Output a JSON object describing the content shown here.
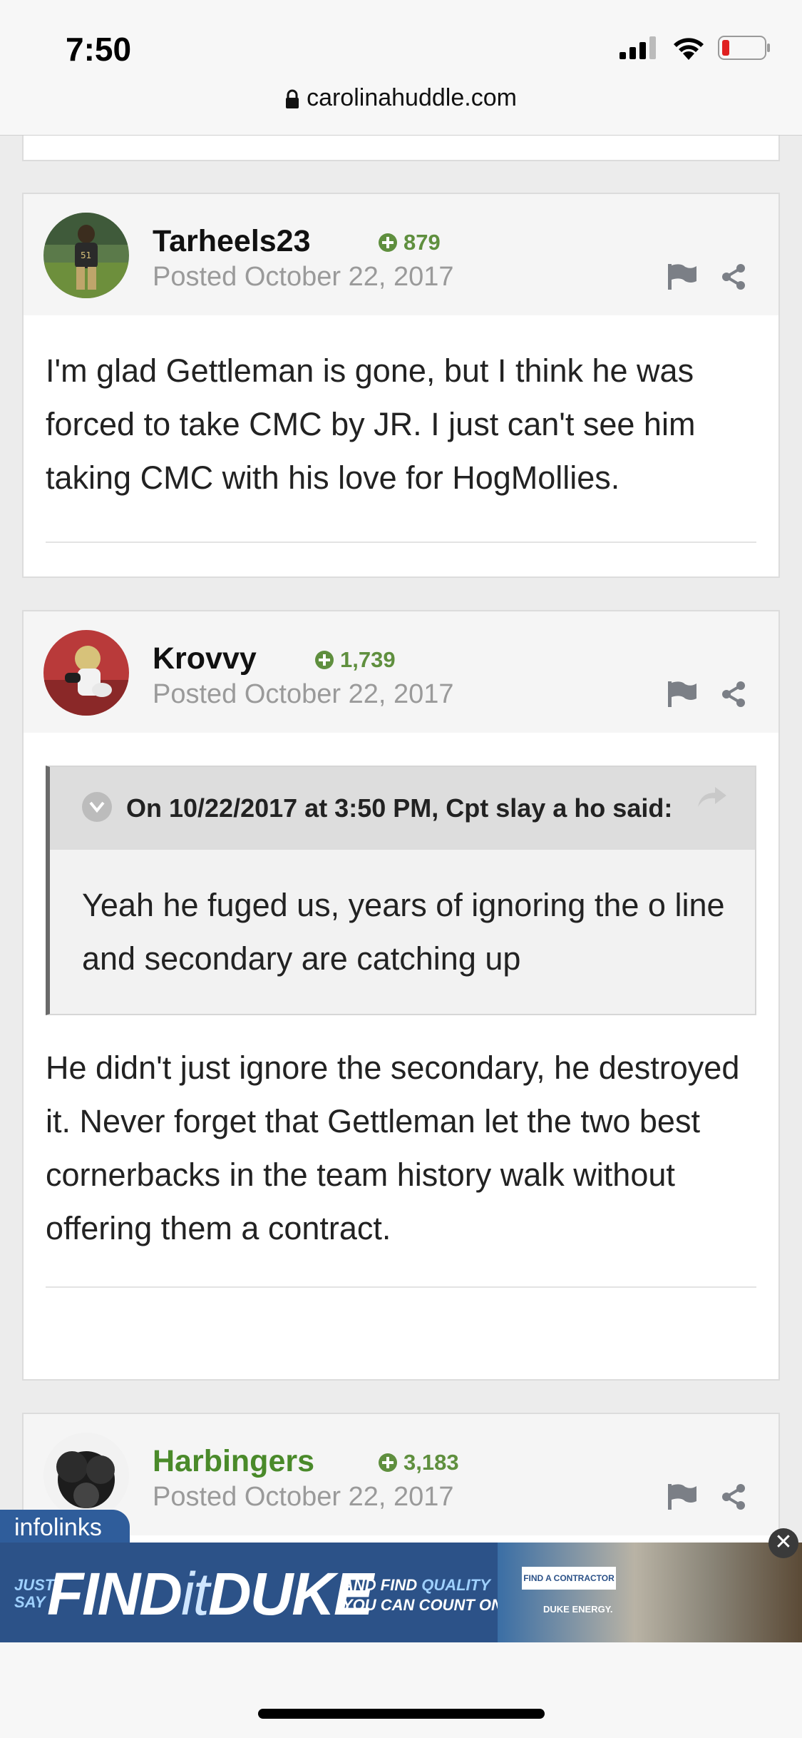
{
  "status_bar": {
    "time": "7:50"
  },
  "browser": {
    "url": "carolinahuddle.com"
  },
  "posts": [
    {
      "username": "Tarheels23",
      "reputation": "879",
      "posted": "Posted October 22, 2017",
      "content": "I'm glad Gettleman is gone, but I think he was forced to take CMC by JR. I just can't see him taking CMC with his love for HogMollies."
    },
    {
      "username": "Krovvy",
      "reputation": "1,739",
      "posted": "Posted October 22, 2017",
      "quote": {
        "citation": "On 10/22/2017 at 3:50 PM, Cpt slay a ho said:",
        "text": "Yeah he fuged us, years of ignoring the o line and secondary are catching up"
      },
      "content": "He didn't just ignore the secondary, he destroyed it. Never forget that Gettleman let the two best cornerbacks in the team history walk without offering them a contract."
    },
    {
      "username": "Harbingers",
      "reputation": "3,183",
      "posted": "Posted October 22, 2017"
    }
  ],
  "ad": {
    "network": "infolinks",
    "just_say": "JUST SAY",
    "find": "FIND",
    "it": "it",
    "brand": "DUKE",
    "tagline_prefix": "AND FIND ",
    "tagline_quality": "QUALITY",
    "tagline_suffix": "YOU CAN COUNT ON.",
    "cta": "FIND A CONTRACTOR",
    "logo": "DUKE ENERGY.",
    "close": "✕"
  },
  "icons": [
    "lock-icon",
    "signal-icon",
    "wifi-icon",
    "battery-icon",
    "plus-circle-icon",
    "flag-icon",
    "share-icon",
    "chevron-down-icon",
    "reply-arrow-icon",
    "close-icon"
  ]
}
